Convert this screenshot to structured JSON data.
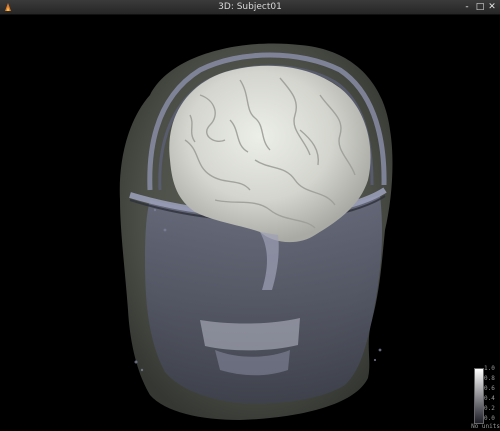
{
  "window": {
    "title": "3D: Subject01",
    "icon": "app-logo-icon",
    "buttons": {
      "minimize": "-",
      "maximize": "□",
      "close": "✕"
    }
  },
  "colorbar": {
    "ticks": [
      "1.0",
      "0.8",
      "0.6",
      "0.4",
      "0.2",
      "0.0"
    ],
    "units": "No units"
  },
  "colors": {
    "background": "#000000",
    "head_surface": "#5d6158",
    "brain_surface": "#d9dbd4",
    "skull": "#8a8fa8"
  }
}
